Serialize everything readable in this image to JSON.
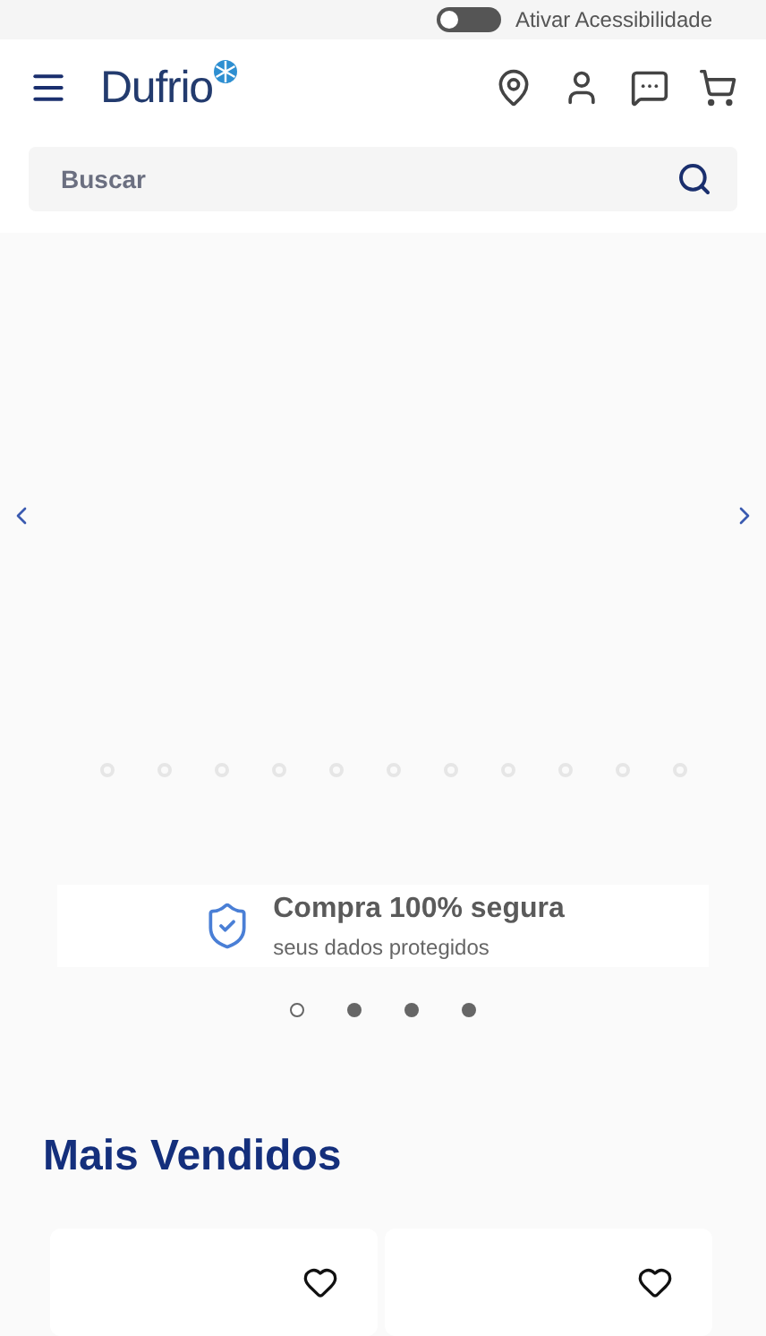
{
  "accessibility": {
    "label": "Ativar Acessibilidade",
    "on": false
  },
  "header": {
    "logo": "Dufrio",
    "search": {
      "placeholder": "Buscar"
    }
  },
  "hero": {
    "dots": [
      {
        "selected": false
      },
      {
        "selected": false
      },
      {
        "selected": false
      },
      {
        "selected": false
      },
      {
        "selected": false
      },
      {
        "selected": false
      },
      {
        "selected": false
      },
      {
        "selected": false
      },
      {
        "selected": false
      },
      {
        "selected": false
      },
      {
        "selected": false
      }
    ]
  },
  "trust_banner": {
    "title": "Compra 100% segura",
    "subtitle": "seus dados protegidos",
    "dots": [
      {
        "selected": true
      },
      {
        "selected": false
      },
      {
        "selected": false
      },
      {
        "selected": false
      }
    ]
  },
  "section": {
    "title": "Mais Vendidos",
    "products": [
      {
        "favorite": false
      },
      {
        "favorite": false
      }
    ]
  }
}
